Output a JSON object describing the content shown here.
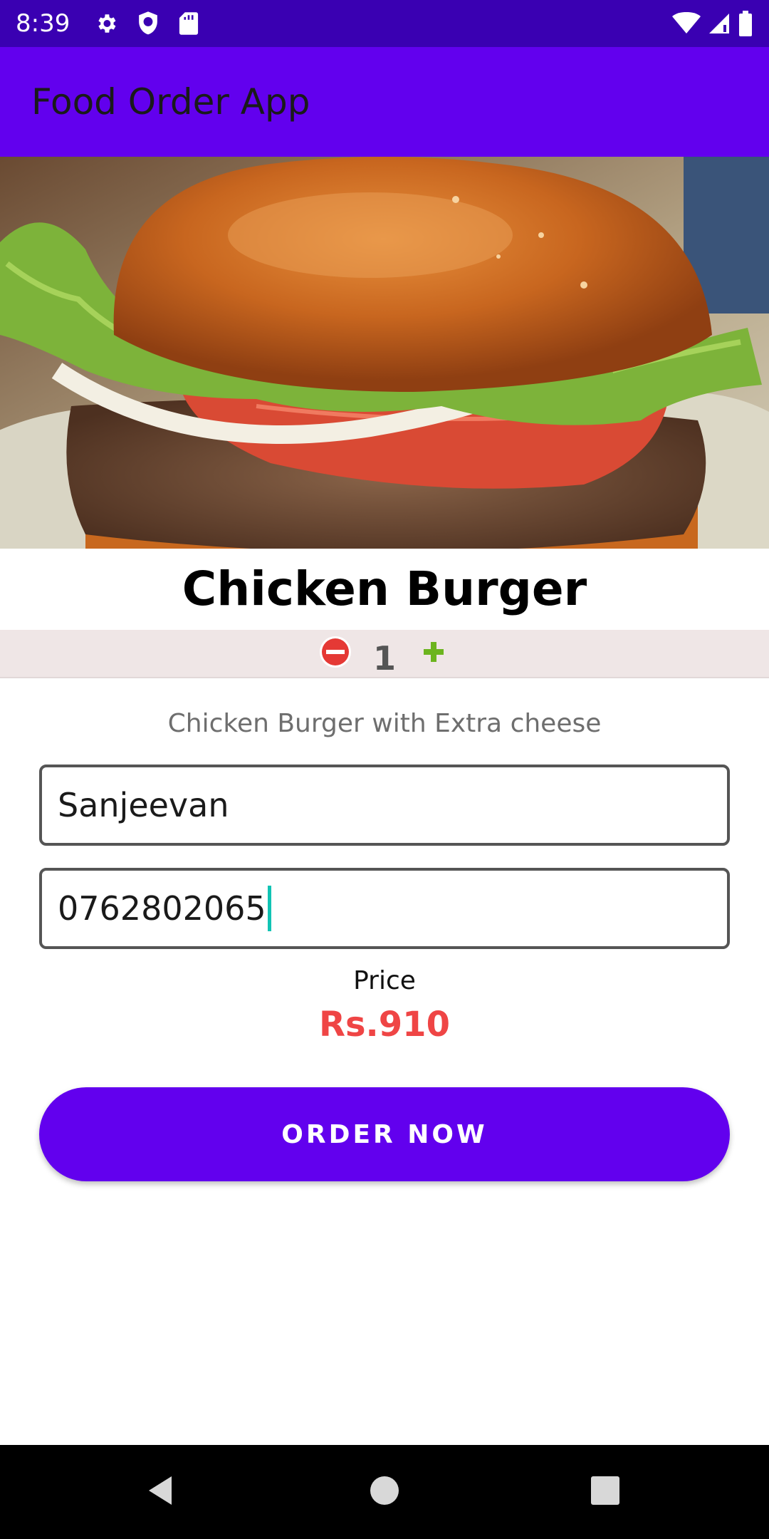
{
  "status_bar": {
    "time": "8:39",
    "icons": [
      "gear-icon",
      "shield-icon",
      "sd-card-icon",
      "wifi-icon",
      "signal-icon",
      "battery-icon"
    ]
  },
  "app_bar": {
    "title": "Food Order App",
    "background": "#6200ee"
  },
  "hero": {
    "image": "burger-photo"
  },
  "food": {
    "name": "Chicken Burger",
    "description": "Chicken Burger with Extra cheese"
  },
  "quantity": {
    "value": "1",
    "decrement_icon": "minus-circle-icon",
    "increment_icon": "plus-icon"
  },
  "form": {
    "name_value": "Sanjeevan",
    "phone_value": "0762802065"
  },
  "price": {
    "label": "Price",
    "value": "Rs.910",
    "color": "#ef4545"
  },
  "order_button": {
    "label": "ORDER NOW",
    "color": "#6200ee"
  },
  "nav_bar": {
    "icons": [
      "back-icon",
      "home-icon",
      "recents-icon"
    ]
  }
}
